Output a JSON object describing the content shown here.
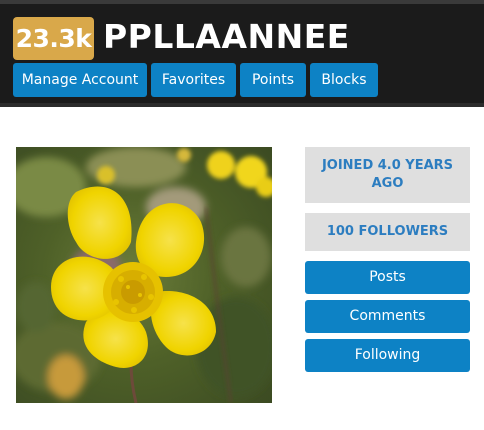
{
  "profile": {
    "points": "23.3k",
    "username": "PPLLAANNEE"
  },
  "nav": {
    "manage_account": "Manage Account",
    "favorites": "Favorites",
    "points": "Points",
    "blocks": "Blocks"
  },
  "stats": {
    "joined": "JOINED 4.0 YEARS AGO",
    "followers": "100 FOLLOWERS"
  },
  "actions": {
    "posts": "Posts",
    "comments": "Comments",
    "following": "Following"
  },
  "colors": {
    "header_bg": "#1b1b1b",
    "badge": "#d9a84a",
    "accent": "#0d82c5",
    "stat_bg": "#dfdfdf",
    "stat_text": "#2c7dc0"
  }
}
